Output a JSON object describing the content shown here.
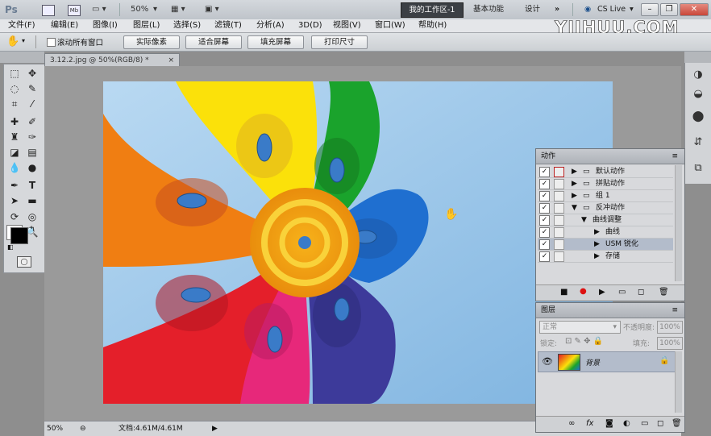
{
  "titlebar": {
    "app_logo": "Ps",
    "zoom": "50%",
    "workspaces": {
      "active": "我的工作区-1",
      "basic": "基本功能",
      "design": "设计",
      "more": "»"
    },
    "cslive": "CS Live"
  },
  "menu": [
    "文件(F)",
    "编辑(E)",
    "图像(I)",
    "图层(L)",
    "选择(S)",
    "滤镜(T)",
    "分析(A)",
    "3D(D)",
    "视图(V)",
    "窗口(W)",
    "帮助(H)"
  ],
  "watermark": "YIIHUU.COM",
  "options": {
    "scroll_all": "滚动所有窗口",
    "actual_pixels": "实际像素",
    "fit_screen": "适合屏幕",
    "fill_screen": "填充屏幕",
    "print_size": "打印尺寸"
  },
  "document": {
    "tab": "3.12.2.jpg @ 50%(RGB/8) *",
    "close": "×"
  },
  "status": {
    "zoom": "50%",
    "doc": "文档:4.61M/4.61M"
  },
  "actions_panel": {
    "title": "动作",
    "rows": [
      {
        "label": "默认动作",
        "level": 0
      },
      {
        "label": "拼贴动作",
        "level": 0
      },
      {
        "label": "组 1",
        "level": 0
      },
      {
        "label": "反冲动作",
        "level": 0
      },
      {
        "label": "曲线调整",
        "level": 1
      },
      {
        "label": "曲线",
        "level": 2
      },
      {
        "label": "USM 锐化",
        "level": 2,
        "selected": true
      },
      {
        "label": "存储",
        "level": 2
      }
    ]
  },
  "layers_panel": {
    "title": "图层",
    "blend_mode": "正常",
    "opacity_label": "不透明度:",
    "opacity_value": "100%",
    "lock_label": "锁定:",
    "fill_label": "填充:",
    "fill_value": "100%",
    "layer_name": "背景"
  },
  "colors": {
    "accent_select": "#b3bccb",
    "sky": "#8ec0e8"
  }
}
